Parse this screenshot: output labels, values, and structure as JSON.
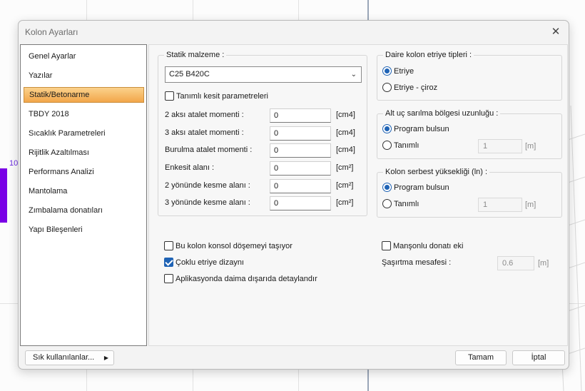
{
  "background": {
    "tick_label": "10"
  },
  "dialog": {
    "title": "Kolon Ayarları",
    "close_glyph": "✕"
  },
  "sidebar": {
    "items": [
      {
        "label": "Genel Ayarlar",
        "active": false
      },
      {
        "label": "Yazılar",
        "active": false
      },
      {
        "label": "Statik/Betonarme",
        "active": true
      },
      {
        "label": "TBDY 2018",
        "active": false
      },
      {
        "label": "Sıcaklık Parametreleri",
        "active": false
      },
      {
        "label": "Rijitlik Azaltılması",
        "active": false
      },
      {
        "label": "Performans Analizi",
        "active": false
      },
      {
        "label": "Mantolama",
        "active": false
      },
      {
        "label": "Zımbalama donatıları",
        "active": false
      },
      {
        "label": "Yapı Bileşenleri",
        "active": false
      }
    ]
  },
  "material": {
    "legend": "Statik malzeme :",
    "selected": "C25 B420C",
    "custom_section": {
      "label": "Tanımlı kesit parametreleri",
      "checked": false
    },
    "fields": [
      {
        "label": "2 aksı atalet momenti :",
        "value": "0",
        "unit": "[cm4]"
      },
      {
        "label": "3 aksı atalet momenti :",
        "value": "0",
        "unit": "[cm4]"
      },
      {
        "label": "Burulma atalet momenti :",
        "value": "0",
        "unit": "[cm4]"
      },
      {
        "label": "Enkesit alanı :",
        "value": "0",
        "unit": "[cm²]"
      },
      {
        "label": "2 yönünde kesme alanı :",
        "value": "0",
        "unit": "[cm²]"
      },
      {
        "label": "3 yönünde kesme alanı :",
        "value": "0",
        "unit": "[cm²]"
      }
    ]
  },
  "options": {
    "consol": {
      "label": "Bu kolon konsol döşemeyi taşıyor",
      "checked": false
    },
    "multi_stirrup": {
      "label": "Çoklu etriye dizaynı",
      "checked": true
    },
    "detail_outside": {
      "label": "Aplikasyonda daima dışarıda detaylandır",
      "checked": false
    }
  },
  "circular": {
    "legend": "Daire kolon etriye tipleri :",
    "opt1": "Etriye",
    "opt2": "Etriye - çiroz",
    "selected": "Etriye"
  },
  "bottom_zone": {
    "legend": "Alt uç sarılma bölgesi uzunluğu :",
    "opt1": "Program bulsun",
    "opt2": "Tanımlı",
    "value": "1",
    "unit": "[m]"
  },
  "free_height": {
    "legend": "Kolon serbest yüksekliği (ln) :",
    "opt1": "Program bulsun",
    "opt2": "Tanımlı",
    "value": "1",
    "unit": "[m]"
  },
  "sleeve": {
    "label": "Manşonlu donatı eki",
    "checked": false,
    "offset_label": "Şaşırtma mesafesi :",
    "offset_value": "0.6",
    "offset_unit": "[m]"
  },
  "footer": {
    "favorites": "Sık kullanılanlar...",
    "favorites_arrow": "▶",
    "ok": "Tamam",
    "cancel": "İptal"
  }
}
